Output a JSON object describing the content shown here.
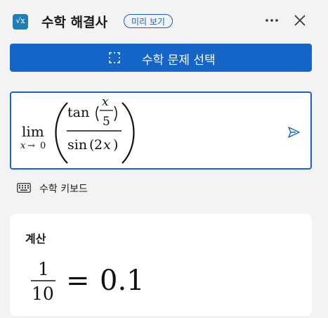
{
  "header": {
    "title": "수학 해결사",
    "badge": "미리 보기",
    "app_icon_text": "√x",
    "app_icon_color": "#1f7fb5",
    "more_icon": "more-horizontal-icon",
    "close_icon": "close-icon"
  },
  "select_button": {
    "label": "수학 문제 선택",
    "icon": "selection-icon",
    "color": "#1565c8"
  },
  "math_input": {
    "lim": "lim",
    "sub_var": "x",
    "sub_arrow": "→",
    "sub_val": "0",
    "numerator_fn": "tan",
    "inner_num": "x",
    "inner_den": "5",
    "denominator_fn": "sin",
    "den_coef": "2",
    "den_var": "x",
    "submit_icon": "send-icon"
  },
  "keyboard": {
    "label": "수학 키보드",
    "icon": "keyboard-icon"
  },
  "result_card": {
    "title": "계산",
    "numerator": "1",
    "denominator": "10",
    "equals": "=",
    "value": "0.1"
  }
}
